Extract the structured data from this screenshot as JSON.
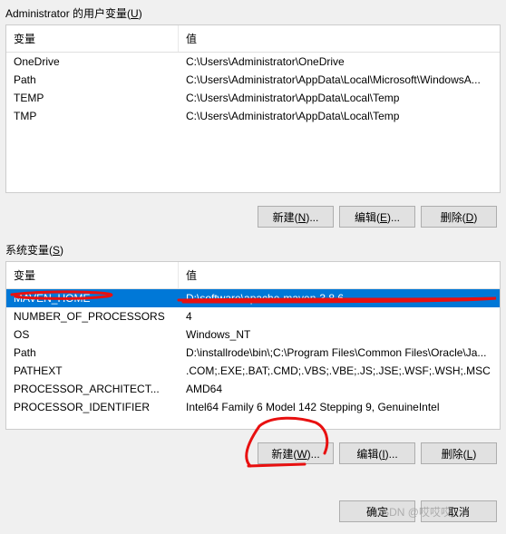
{
  "user_section": {
    "title_prefix": "Administrator 的用户变量(",
    "title_hotkey": "U",
    "title_suffix": ")",
    "columns": {
      "var": "变量",
      "val": "值"
    },
    "rows": [
      {
        "name": "OneDrive",
        "value": "C:\\Users\\Administrator\\OneDrive"
      },
      {
        "name": "Path",
        "value": "C:\\Users\\Administrator\\AppData\\Local\\Microsoft\\WindowsA..."
      },
      {
        "name": "TEMP",
        "value": "C:\\Users\\Administrator\\AppData\\Local\\Temp"
      },
      {
        "name": "TMP",
        "value": "C:\\Users\\Administrator\\AppData\\Local\\Temp"
      }
    ],
    "buttons": {
      "new_prefix": "新建(",
      "new_hotkey": "N",
      "new_suffix": ")...",
      "edit_prefix": "编辑(",
      "edit_hotkey": "E",
      "edit_suffix": ")...",
      "delete_prefix": "删除(",
      "delete_hotkey": "D",
      "delete_suffix": ")"
    }
  },
  "system_section": {
    "title_prefix": "系统变量(",
    "title_hotkey": "S",
    "title_suffix": ")",
    "columns": {
      "var": "变量",
      "val": "值"
    },
    "rows": [
      {
        "name": "MAVEN_HOME",
        "value": "D:\\software\\apache-maven-3.8.6",
        "selected": true
      },
      {
        "name": "NUMBER_OF_PROCESSORS",
        "value": "4"
      },
      {
        "name": "OS",
        "value": "Windows_NT"
      },
      {
        "name": "Path",
        "value": "D:\\installrode\\bin\\;C:\\Program Files\\Common Files\\Oracle\\Ja..."
      },
      {
        "name": "PATHEXT",
        "value": ".COM;.EXE;.BAT;.CMD;.VBS;.VBE;.JS;.JSE;.WSF;.WSH;.MSC"
      },
      {
        "name": "PROCESSOR_ARCHITECT...",
        "value": "AMD64"
      },
      {
        "name": "PROCESSOR_IDENTIFIER",
        "value": "Intel64 Family 6 Model 142 Stepping 9, GenuineIntel"
      }
    ],
    "buttons": {
      "new_prefix": "新建(",
      "new_hotkey": "W",
      "new_suffix": ")...",
      "edit_prefix": "编辑(",
      "edit_hotkey": "I",
      "edit_suffix": ")...",
      "delete_prefix": "删除(",
      "delete_hotkey": "L",
      "delete_suffix": ")"
    }
  },
  "dialog": {
    "ok": "确定",
    "cancel": "取消"
  },
  "watermark": "CSDN @哎哎哎"
}
